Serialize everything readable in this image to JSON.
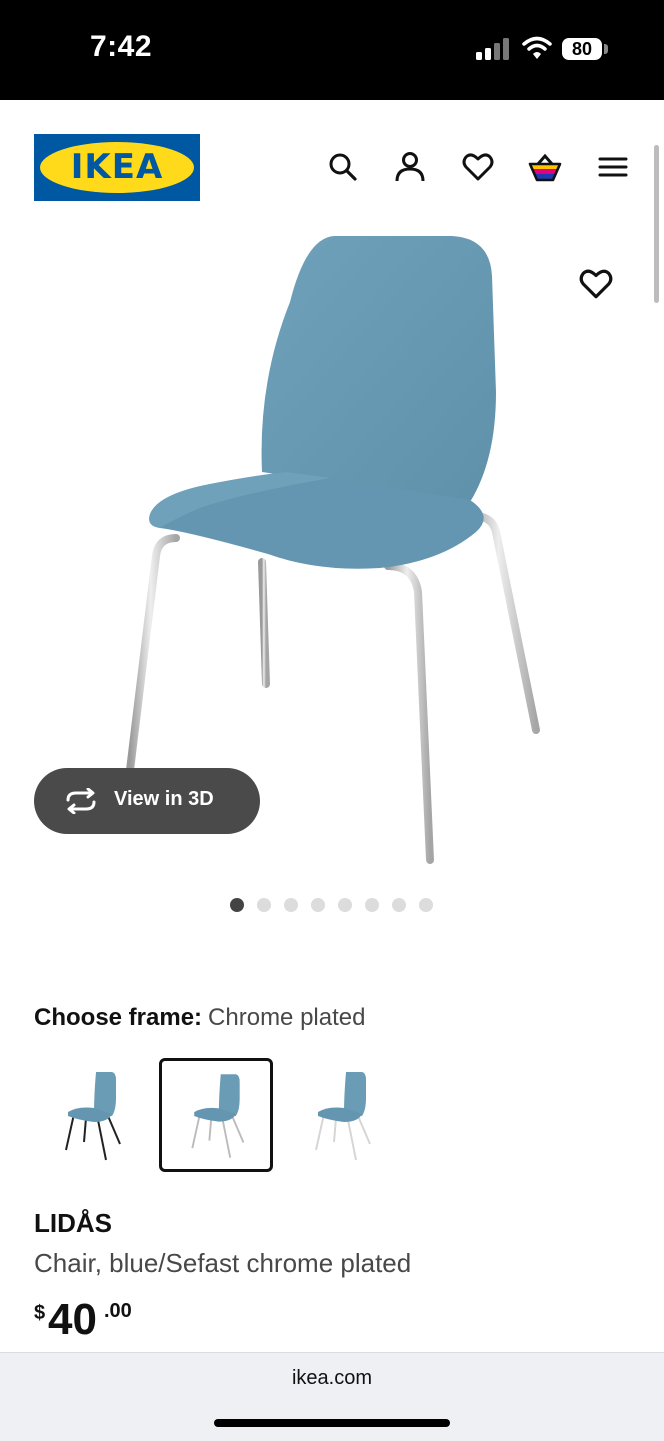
{
  "status_bar": {
    "time": "7:42",
    "battery": "80"
  },
  "header": {
    "logo_text": "IKEA",
    "icons": [
      "search-icon",
      "account-icon",
      "heart-icon",
      "shopping-basket-icon",
      "menu-icon"
    ]
  },
  "gallery": {
    "view_3d_label": "View in 3D",
    "image_count": 8,
    "active_index": 0
  },
  "frame": {
    "label": "Choose frame:",
    "value": "Chrome plated",
    "options": [
      "Black",
      "Chrome plated",
      "White"
    ],
    "selected_index": 1
  },
  "product": {
    "name": "LIDÅS",
    "description": "Chair, blue/Sefast chrome plated",
    "price_currency": "$",
    "price_main": "40",
    "price_cents": ".00"
  },
  "browser": {
    "url": "ikea.com"
  },
  "colors": {
    "ikea_blue": "#0058a3",
    "ikea_yellow": "#ffda1a",
    "seat_blue": "#6b9cb6",
    "chrome": "#c9c9c9"
  }
}
